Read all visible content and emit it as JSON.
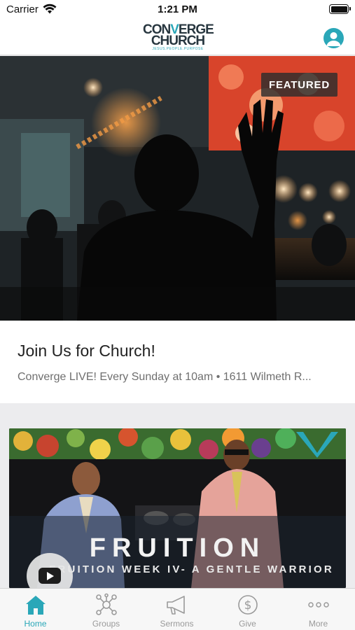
{
  "status_bar": {
    "carrier": "Carrier",
    "time": "1:21 PM"
  },
  "header": {
    "logo_line1_a": "CON",
    "logo_line1_v": "V",
    "logo_line1_b": "ERGE",
    "logo_line2": "CHURCH",
    "logo_tagline": "JESUS.PEOPLE.PURPOSE",
    "profile_icon": "person-icon"
  },
  "featured": {
    "badge": "FEATURED",
    "title": "Join Us for Church!",
    "subtitle": "Converge LIVE! Every Sunday at 10am • 1611 Wilmeth R..."
  },
  "sermon_card": {
    "title": "FRUITION",
    "subtitle": "FRUITION WEEK IV- A GENTLE WARRIOR",
    "play_icon": "youtube-play-icon"
  },
  "tabs": [
    {
      "label": "Home",
      "icon": "home-icon",
      "active": true
    },
    {
      "label": "Groups",
      "icon": "network-icon",
      "active": false
    },
    {
      "label": "Sermons",
      "icon": "megaphone-icon",
      "active": false
    },
    {
      "label": "Give",
      "icon": "dollar-icon",
      "active": false
    },
    {
      "label": "More",
      "icon": "ellipsis-icon",
      "active": false
    }
  ],
  "colors": {
    "accent": "#2aa7b8",
    "dark": "#27363f",
    "tab_inactive": "#9a9a9a"
  }
}
